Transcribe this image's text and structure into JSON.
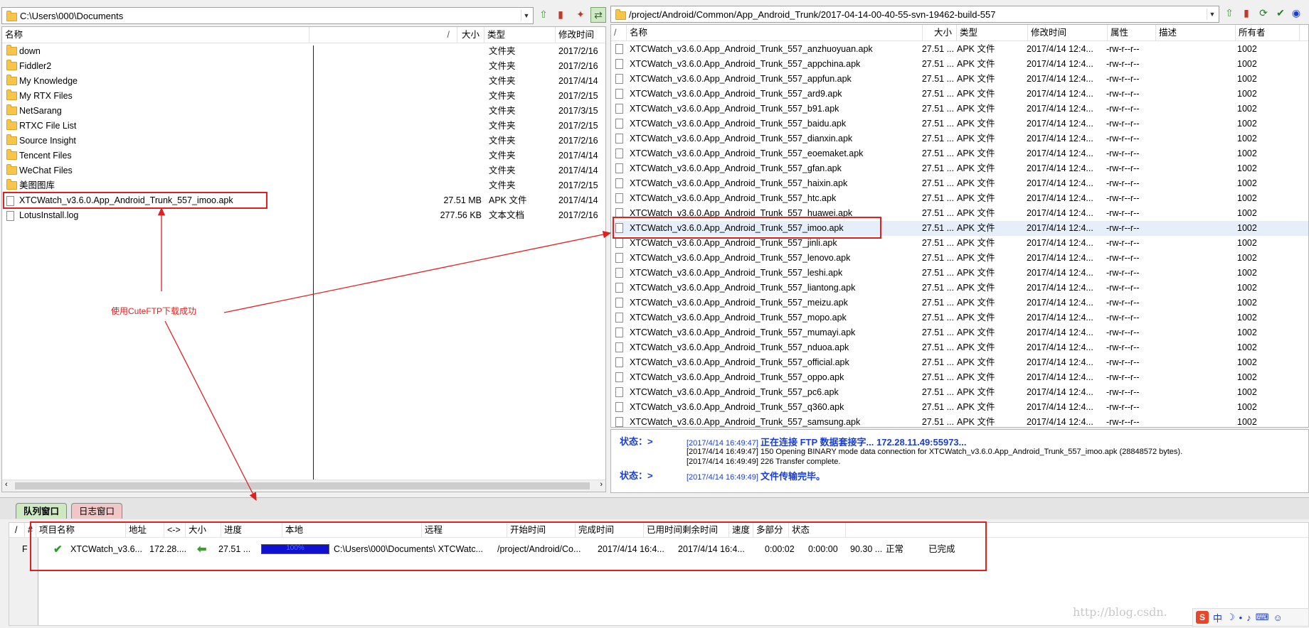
{
  "left": {
    "path": "C:\\Users\\000\\Documents",
    "columns": [
      "名称",
      "/",
      "大小",
      "类型",
      "修改时间"
    ],
    "rows": [
      {
        "name": "down",
        "size": "",
        "type": "文件夹",
        "date": "2017/2/16",
        "icon": "folder-icon"
      },
      {
        "name": "Fiddler2",
        "size": "",
        "type": "文件夹",
        "date": "2017/2/16",
        "icon": "folder-icon"
      },
      {
        "name": "My Knowledge",
        "size": "",
        "type": "文件夹",
        "date": "2017/4/14",
        "icon": "folder-icon"
      },
      {
        "name": "My RTX Files",
        "size": "",
        "type": "文件夹",
        "date": "2017/2/15",
        "icon": "folder-icon"
      },
      {
        "name": "NetSarang",
        "size": "",
        "type": "文件夹",
        "date": "2017/3/15",
        "icon": "folder-icon"
      },
      {
        "name": "RTXC File List",
        "size": "",
        "type": "文件夹",
        "date": "2017/2/15",
        "icon": "folder-icon"
      },
      {
        "name": "Source Insight",
        "size": "",
        "type": "文件夹",
        "date": "2017/2/16",
        "icon": "folder-icon"
      },
      {
        "name": "Tencent Files",
        "size": "",
        "type": "文件夹",
        "date": "2017/4/14",
        "icon": "folder-icon"
      },
      {
        "name": "WeChat Files",
        "size": "",
        "type": "文件夹",
        "date": "2017/4/14",
        "icon": "folder-icon"
      },
      {
        "name": "美图图库",
        "size": "",
        "type": "文件夹",
        "date": "2017/2/15",
        "icon": "folder-icon"
      },
      {
        "name": "XTCWatch_v3.6.0.App_Android_Trunk_557_imoo.apk",
        "size": "27.51 MB",
        "type": "APK 文件",
        "date": "2017/4/14",
        "icon": "file-icon"
      },
      {
        "name": "LotusInstall.log",
        "size": "277.56 KB",
        "type": "文本文档",
        "date": "2017/2/16",
        "icon": "file-icon"
      }
    ]
  },
  "right": {
    "path": "/project/Android/Common/App_Android_Trunk/2017-04-14-00-40-55-svn-19462-build-557",
    "columns": [
      "/",
      "名称",
      "大小",
      "类型",
      "修改时间",
      "属性",
      "描述",
      "所有者"
    ],
    "row_common": {
      "size": "27.51 ...",
      "type": "APK 文件",
      "date": "2017/4/14 12:4...",
      "attr": "-rw-r--r--",
      "owner": "1002"
    },
    "rows": [
      "XTCWatch_v3.6.0.App_Android_Trunk_557_anzhuoyuan.apk",
      "XTCWatch_v3.6.0.App_Android_Trunk_557_appchina.apk",
      "XTCWatch_v3.6.0.App_Android_Trunk_557_appfun.apk",
      "XTCWatch_v3.6.0.App_Android_Trunk_557_ard9.apk",
      "XTCWatch_v3.6.0.App_Android_Trunk_557_b91.apk",
      "XTCWatch_v3.6.0.App_Android_Trunk_557_baidu.apk",
      "XTCWatch_v3.6.0.App_Android_Trunk_557_dianxin.apk",
      "XTCWatch_v3.6.0.App_Android_Trunk_557_eoemaket.apk",
      "XTCWatch_v3.6.0.App_Android_Trunk_557_gfan.apk",
      "XTCWatch_v3.6.0.App_Android_Trunk_557_haixin.apk",
      "XTCWatch_v3.6.0.App_Android_Trunk_557_htc.apk",
      "XTCWatch_v3.6.0.App_Android_Trunk_557_huawei.apk",
      "XTCWatch_v3.6.0.App_Android_Trunk_557_imoo.apk",
      "XTCWatch_v3.6.0.App_Android_Trunk_557_jinli.apk",
      "XTCWatch_v3.6.0.App_Android_Trunk_557_lenovo.apk",
      "XTCWatch_v3.6.0.App_Android_Trunk_557_leshi.apk",
      "XTCWatch_v3.6.0.App_Android_Trunk_557_liantong.apk",
      "XTCWatch_v3.6.0.App_Android_Trunk_557_meizu.apk",
      "XTCWatch_v3.6.0.App_Android_Trunk_557_mopo.apk",
      "XTCWatch_v3.6.0.App_Android_Trunk_557_mumayi.apk",
      "XTCWatch_v3.6.0.App_Android_Trunk_557_nduoa.apk",
      "XTCWatch_v3.6.0.App_Android_Trunk_557_official.apk",
      "XTCWatch_v3.6.0.App_Android_Trunk_557_oppo.apk",
      "XTCWatch_v3.6.0.App_Android_Trunk_557_pc6.apk",
      "XTCWatch_v3.6.0.App_Android_Trunk_557_q360.apk",
      "XTCWatch_v3.6.0.App_Android_Trunk_557_samsung.apk"
    ]
  },
  "log": {
    "line1_label": "状态：>",
    "line1_ts": "[2017/4/14 16:49:47]",
    "line1_msg": "正在连接 FTP 数据套接字... 172.28.11.49:55973...",
    "line2": "[2017/4/14 16:49:47] 150 Opening BINARY mode data connection for  XTCWatch_v3.6.0.App_Android_Trunk_557_imoo.apk (28848572 bytes).",
    "line3": "[2017/4/14 16:49:49] 226 Transfer complete.",
    "line4_label": "状态：>",
    "line4_ts": "[2017/4/14 16:49:49]",
    "line4_msg": "文件传输完毕。"
  },
  "annotation": "使用CuteFTP下载成功",
  "tabs": {
    "queue": "队列窗口",
    "log": "日志窗口"
  },
  "queue": {
    "columns": [
      "/",
      "#",
      "项目名称",
      "地址",
      "<->",
      "大小",
      "进度",
      "本地",
      "远程",
      "开始时间",
      "完成时间",
      "已用时间",
      "剩余时间",
      "速度",
      "多部分",
      "状态"
    ],
    "row": {
      "flag": "F",
      "name": "XTCWatch_v3.6...",
      "address": "172.28....",
      "size": "27.51 ...",
      "progress_label": "100%",
      "progress": 1.0,
      "local": "C:\\Users\\000\\Documents\\ XTCWatc...",
      "remote": "/project/Android/Co...",
      "start": "2017/4/14 16:4...",
      "finish": "2017/4/14 16:4...",
      "elapsed": "0:00:02",
      "remaining": "0:00:00",
      "speed": "90.30 ...",
      "multipart": "正常",
      "status": "已完成"
    }
  },
  "watermark": "http://blog.csdn.",
  "colors": {
    "highlight": "#e02020",
    "progress": "#1010d0",
    "status_blue": "#1a3fd0"
  }
}
